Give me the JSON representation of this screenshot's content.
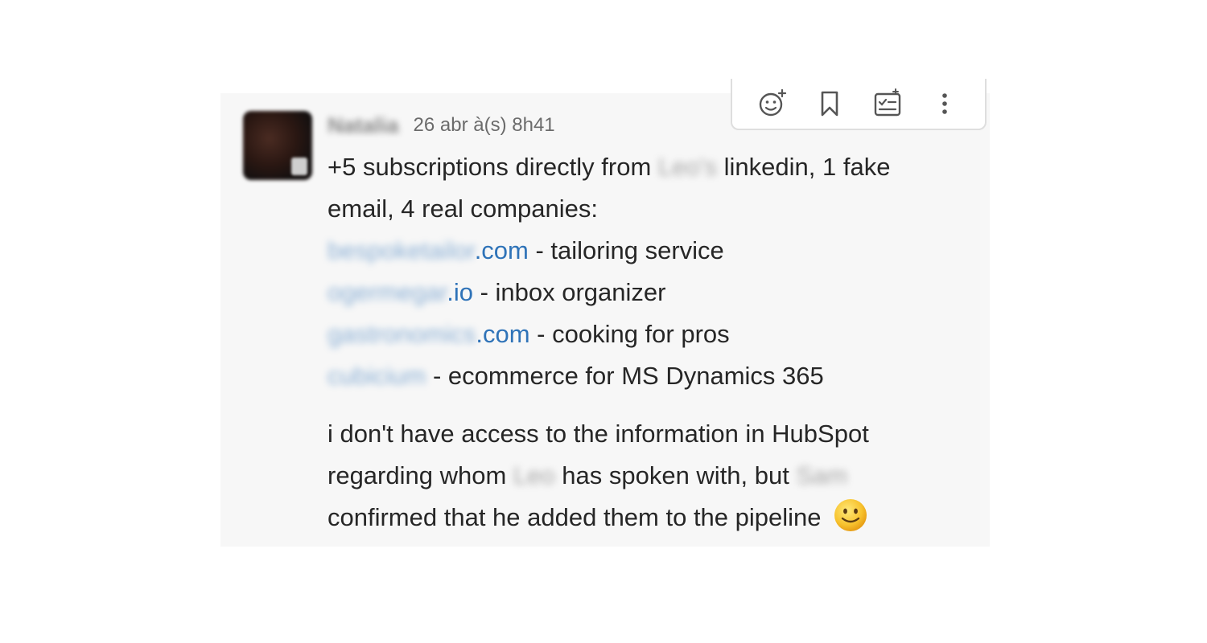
{
  "message": {
    "sender": "Natalia",
    "timestamp": "26 abr à(s) 8h41",
    "intro_prefix": "+5 subscriptions directly from ",
    "intro_name": "Leo's",
    "intro_suffix": " linkedin, 1 fake",
    "intro_line2": "email, 4 real companies:",
    "companies": [
      {
        "link_hidden": "bespoketailor",
        "link_visible": ".com",
        "desc": " - tailoring service"
      },
      {
        "link_hidden": "ogermegar",
        "link_visible": ".io",
        "desc": " - inbox organizer"
      },
      {
        "link_hidden": "gastronomics",
        "link_visible": ".com",
        "desc": " - cooking for pros"
      },
      {
        "link_hidden": "cubicium",
        "link_visible": "",
        "desc": " - ecommerce for MS Dynamics 365"
      }
    ],
    "para2_line1": "i don't have access to the information in HubSpot",
    "para2_line2_prefix": "regarding whom ",
    "para2_name1": "Leo",
    "para2_line2_mid": " has spoken with, but ",
    "para2_name2": "Sam",
    "para2_line3": "confirmed that he added them to the pipeline",
    "emoji": "slightly-smiling-face"
  },
  "toolbar": {
    "actions": [
      "add-reaction",
      "bookmark",
      "create-task",
      "more-actions"
    ]
  },
  "colors": {
    "link": "#2f73b8",
    "panel_bg": "#f7f7f7",
    "text": "#262626"
  }
}
